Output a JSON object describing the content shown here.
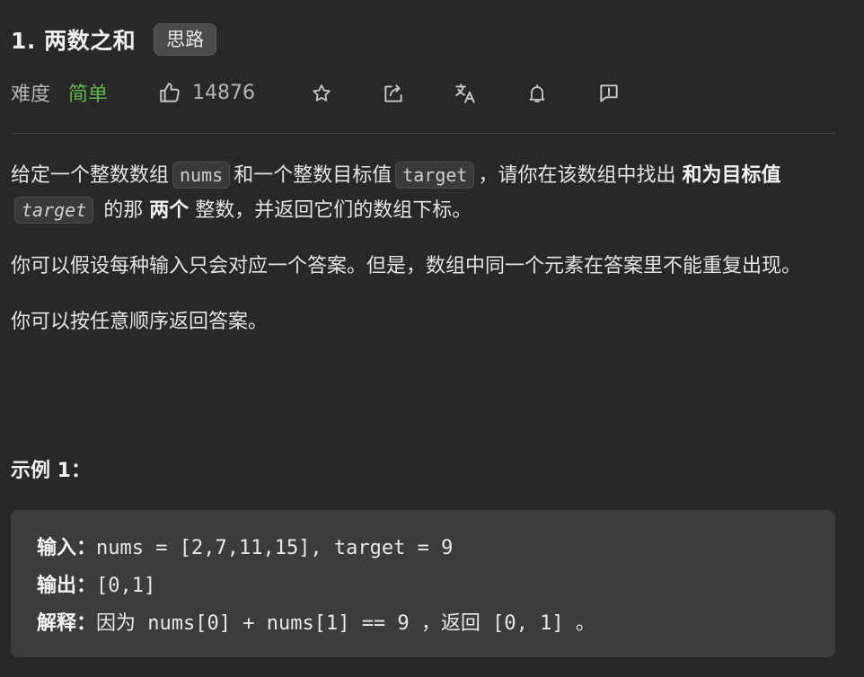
{
  "problem": {
    "title": "1. 两数之和",
    "hint_badge": "思路"
  },
  "meta": {
    "difficulty_label": "难度",
    "difficulty_value": "简单",
    "likes": "14876",
    "icons": [
      "thumbs-up-icon",
      "star-icon",
      "share-icon",
      "translate-icon",
      "bell-icon",
      "feedback-icon"
    ]
  },
  "description": {
    "p1": {
      "t1": "给定一个整数数组",
      "c1": "nums",
      "t2": "和一个整数目标值",
      "c2": "target",
      "t3": "，请你在该数组中找出",
      "b1": "和为目标值",
      "c3": "target",
      "t4": "的那",
      "b2": "两个",
      "t5": "整数，并返回它们的数组下标。"
    },
    "p2": "你可以假设每种输入只会对应一个答案。但是，数组中同一个元素在答案里不能重复出现。",
    "p3": "你可以按任意顺序返回答案。"
  },
  "example1": {
    "title": "示例 1：",
    "input_label": "输入：",
    "input_value": "nums = [2,7,11,15], target = 9",
    "output_label": "输出：",
    "output_value": "[0,1]",
    "explain_label": "解释：",
    "explain_because": "因为",
    "explain_expr": " nums[0] + nums[1] == 9 ，",
    "explain_return": "返回",
    "explain_result": " [0, 1] 。"
  },
  "colors": {
    "background": "#282828",
    "easy_green": "#5fb547",
    "code_bg": "#3c3c3c"
  }
}
